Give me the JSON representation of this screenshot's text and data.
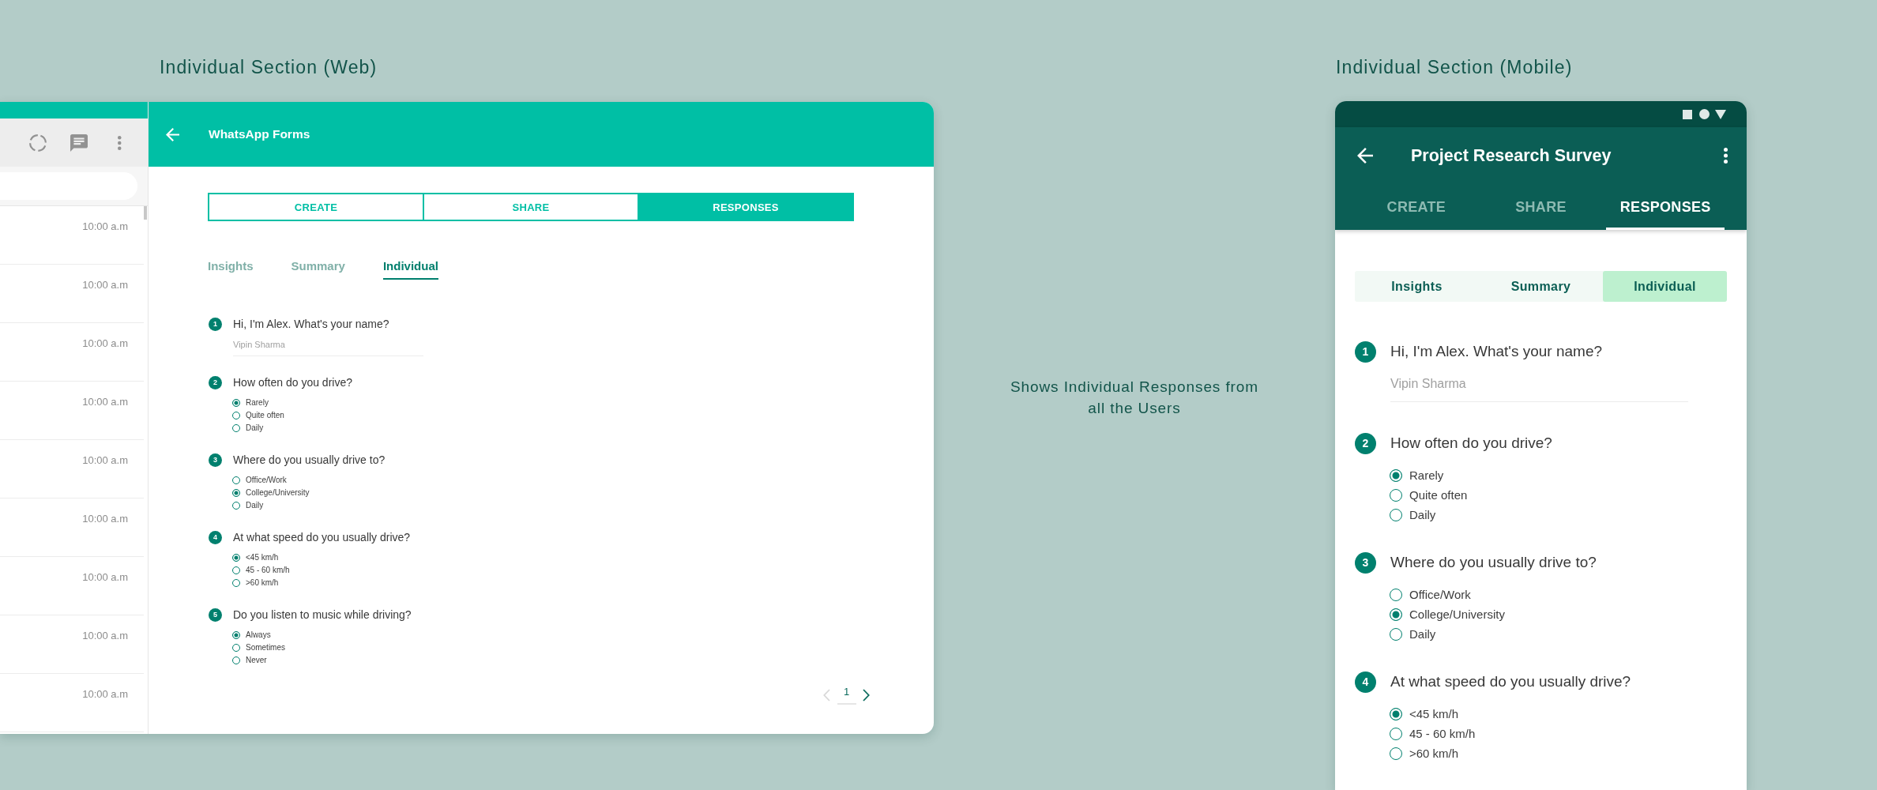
{
  "web": {
    "caption": "Individual Section (Web)",
    "chats": [
      {
        "time": "10:00 a.m"
      },
      {
        "time": "10:00 a.m"
      },
      {
        "time": "10:00 a.m"
      },
      {
        "time": "10:00 a.m"
      },
      {
        "time": "10:00 a.m"
      },
      {
        "time": "10:00 a.m"
      },
      {
        "time": "10:00 a.m"
      },
      {
        "time": "10:00 a.m"
      },
      {
        "time": "10:00 a.m"
      }
    ],
    "header": {
      "title": "WhatsApp Forms"
    },
    "tabs": [
      {
        "label": "CREATE",
        "selected": false
      },
      {
        "label": "SHARE",
        "selected": false
      },
      {
        "label": "RESPONSES",
        "selected": true
      }
    ],
    "subtabs": [
      {
        "label": "Insights",
        "selected": false
      },
      {
        "label": "Summary",
        "selected": false
      },
      {
        "label": "Individual",
        "selected": true
      }
    ],
    "questions": [
      {
        "number": "1",
        "kind": "text",
        "text": "Hi, I'm Alex. What's your name?",
        "answer": "Vipin Sharma"
      },
      {
        "number": "2",
        "kind": "choice",
        "text": "How often do you drive?",
        "options": [
          {
            "label": "Rarely",
            "selected": true
          },
          {
            "label": "Quite often",
            "selected": false
          },
          {
            "label": "Daily",
            "selected": false
          }
        ]
      },
      {
        "number": "3",
        "kind": "choice",
        "text": "Where do you usually drive to?",
        "options": [
          {
            "label": "Office/Work",
            "selected": false
          },
          {
            "label": "College/University",
            "selected": true
          },
          {
            "label": "Daily",
            "selected": false
          }
        ]
      },
      {
        "number": "4",
        "kind": "choice",
        "text": "At what speed do you usually drive?",
        "options": [
          {
            "label": "<45 km/h",
            "selected": true
          },
          {
            "label": "45 - 60 km/h",
            "selected": false
          },
          {
            "label": ">60 km/h",
            "selected": false
          }
        ]
      },
      {
        "number": "5",
        "kind": "choice",
        "text": "Do you listen to music while driving?",
        "options": [
          {
            "label": "Always",
            "selected": true
          },
          {
            "label": "Sometimes",
            "selected": false
          },
          {
            "label": "Never",
            "selected": false
          }
        ]
      }
    ],
    "pagination": {
      "page": "1",
      "previous_disabled": true,
      "next_disabled": false
    }
  },
  "note": "Shows Individual Responses from all the Users",
  "mobile": {
    "caption": "Individual Section (Mobile)",
    "title": "Project Research Survey",
    "tabs": [
      {
        "label": "CREATE",
        "selected": false
      },
      {
        "label": "SHARE",
        "selected": false
      },
      {
        "label": "RESPONSES",
        "selected": true
      }
    ],
    "subtabs": [
      {
        "label": "Insights",
        "selected": false
      },
      {
        "label": "Summary",
        "selected": false
      },
      {
        "label": "Individual",
        "selected": true
      }
    ],
    "questions": [
      {
        "number": "1",
        "kind": "text",
        "text": "Hi, I'm Alex. What's your name?",
        "answer": "Vipin Sharma"
      },
      {
        "number": "2",
        "kind": "choice",
        "text": "How often do you drive?",
        "options": [
          {
            "label": "Rarely",
            "selected": true
          },
          {
            "label": "Quite often",
            "selected": false
          },
          {
            "label": "Daily",
            "selected": false
          }
        ]
      },
      {
        "number": "3",
        "kind": "choice",
        "text": "Where do you usually drive to?",
        "options": [
          {
            "label": "Office/Work",
            "selected": false
          },
          {
            "label": "College/University",
            "selected": true
          },
          {
            "label": "Daily",
            "selected": false
          }
        ]
      },
      {
        "number": "4",
        "kind": "choice",
        "text": "At what speed do you usually drive?",
        "options": [
          {
            "label": "<45 km/h",
            "selected": true
          },
          {
            "label": "45 - 60 km/h",
            "selected": false
          },
          {
            "label": ">60 km/h",
            "selected": false
          }
        ]
      }
    ]
  }
}
